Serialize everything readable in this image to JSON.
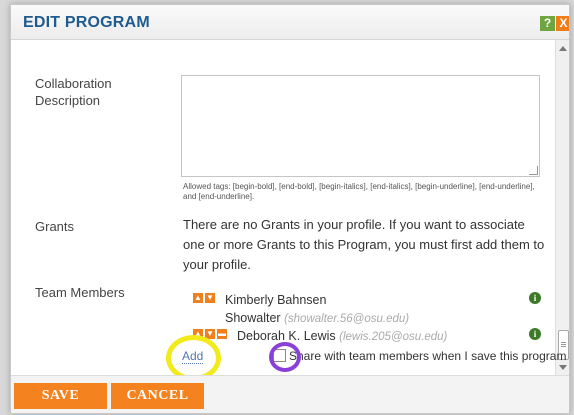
{
  "dialog": {
    "title": "EDIT PROGRAM",
    "help_glyph": "?",
    "close_glyph": "X"
  },
  "fields": {
    "collaboration_label": "Collaboration\nDescription",
    "collaboration_value": "",
    "allowed_tags": "Allowed tags: [begin-bold], [end-bold], [begin-italics], [end-italics], [begin-underline], [end-underline], and [end-underline].",
    "grants_label": "Grants",
    "grants_text": "There are no Grants in your profile. If you want to associate one or more Grants to this Program, you must first add them to your profile.",
    "team_label": "Team Members"
  },
  "team_members": [
    {
      "name": "Kimberly Bahnsen",
      "name_line2": "Showalter",
      "email": "(showalter.56@osu.edu)"
    },
    {
      "name": "Deborah K. Lewis",
      "email": "(lewis.205@osu.edu)"
    }
  ],
  "actions": {
    "add_label": "Add",
    "share_label": "Share with team members when I save this program",
    "share_checked": false,
    "save_label": "SAVE",
    "cancel_label": "CANCEL"
  },
  "colors": {
    "accent": "#f4821f",
    "title": "#1f5b8f",
    "info": "#3d7a28",
    "highlight_yellow": "#f2ea1a",
    "highlight_purple": "#8a40d8"
  }
}
